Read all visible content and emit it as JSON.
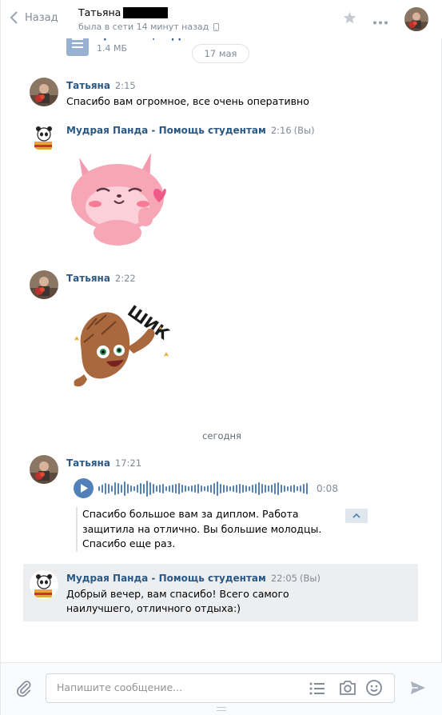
{
  "header": {
    "back_label": "Назад",
    "peer_name": "Татьяна",
    "peer_status": "была в сети 14 минут назад"
  },
  "file": {
    "name": "презентация.ppt",
    "size": "1.4 МБ"
  },
  "date_separator_1": "17 мая",
  "date_separator_2": "сегодня",
  "messages": [
    {
      "author": "Татьяна",
      "time": "2:15",
      "text": "Спасибо вам огромное, все очень оперативно"
    },
    {
      "author": "Мудрая Панда - Помощь студентам",
      "time": "2:16",
      "you": "(Вы)",
      "sticker": "pink-cat-heart-sticker"
    },
    {
      "author": "Татьяна",
      "time": "2:22",
      "sticker": "shik-sticker",
      "sticker_text": "ШИК"
    },
    {
      "author": "Татьяна",
      "time": "17:21",
      "voice_duration": "0:08",
      "transcript": "Спасибо большое вам за диплом. Работа защитила на отлично. Вы большие молодцы. Спасибо еще раз."
    },
    {
      "author": "Мудрая Панда - Помощь студентам",
      "time": "22:05",
      "you": "(Вы)",
      "text": "Добрый вечер, вам спасибо! Всего самого наилучшего, отличного отдыха:)"
    }
  ],
  "composer": {
    "placeholder": "Напишите сообщение..."
  },
  "colors": {
    "accent": "#5181b8",
    "link": "#2a5885",
    "muted": "#828a99",
    "highlight_bg": "#edeef0"
  }
}
